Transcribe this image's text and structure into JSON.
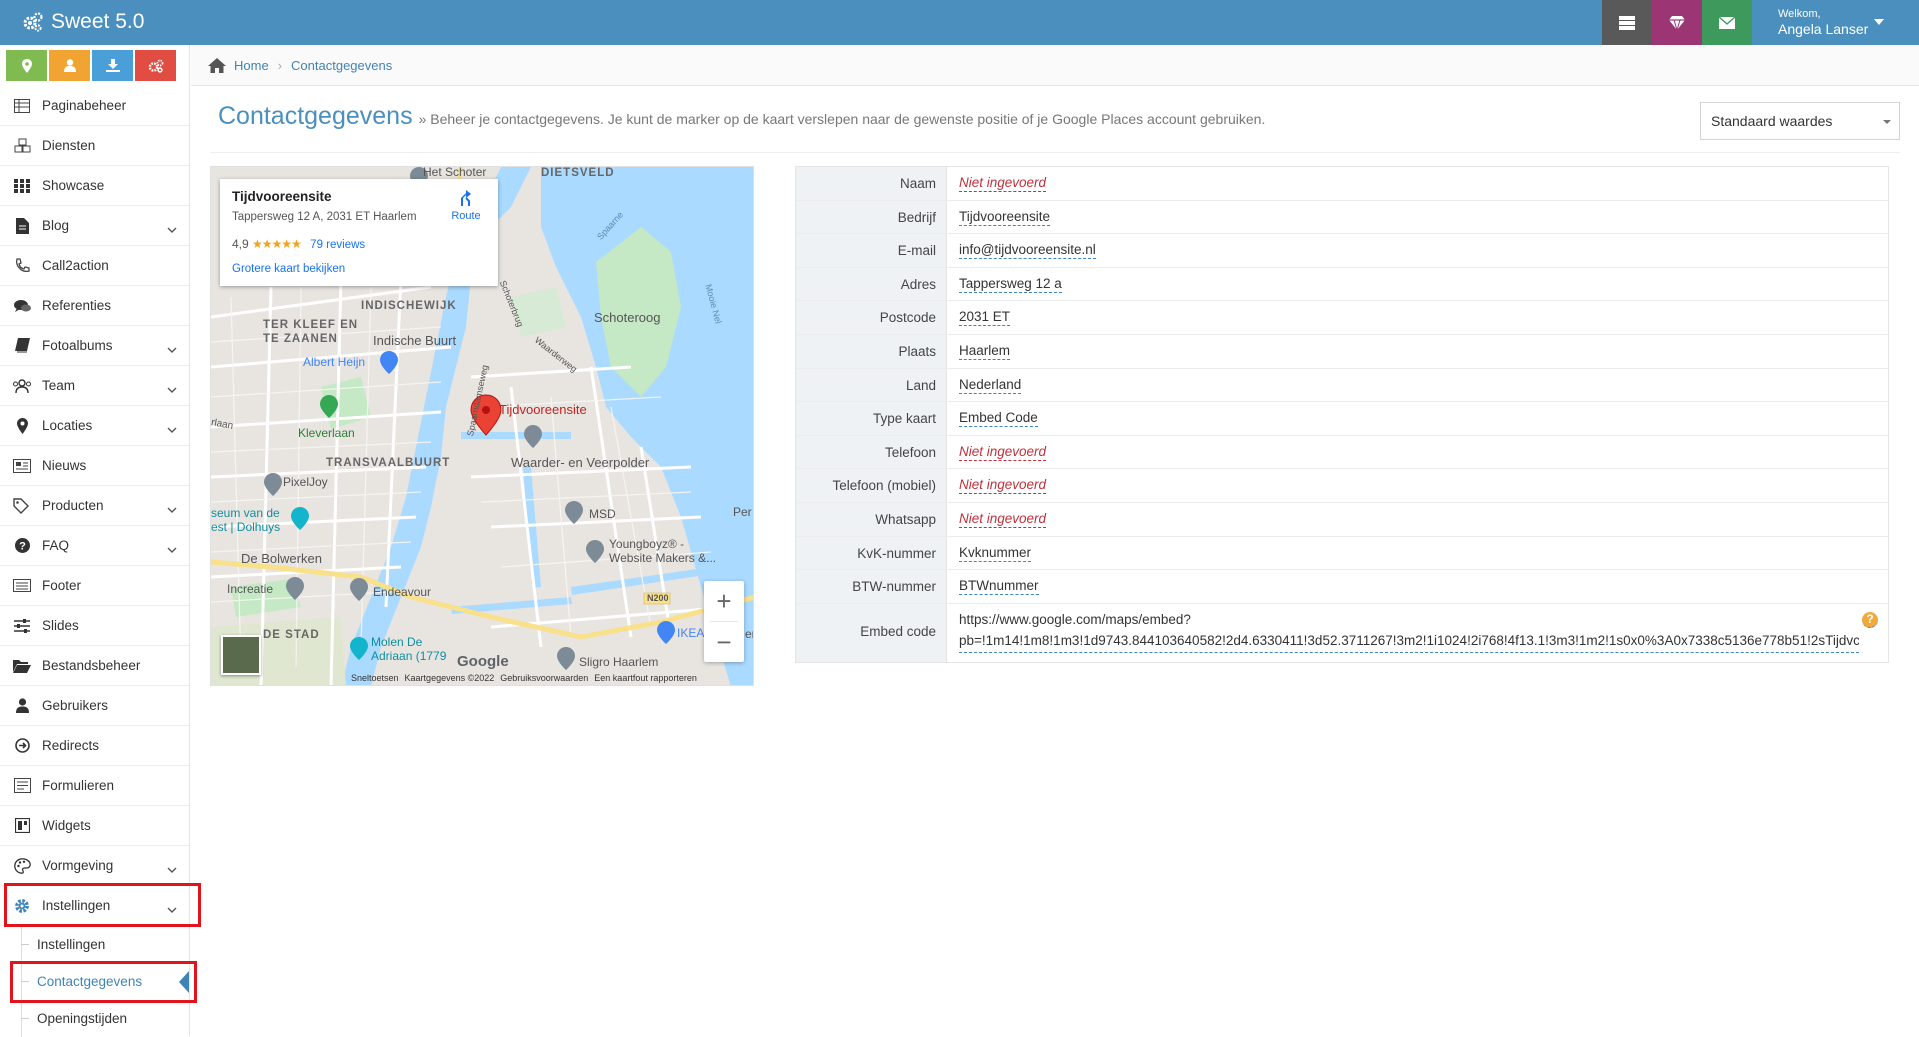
{
  "app": {
    "title": "Sweet 5.0"
  },
  "user": {
    "greeting": "Welkom,",
    "name": "Angela Lanser"
  },
  "breadcrumb": {
    "home": "Home",
    "current": "Contactgegevens"
  },
  "page": {
    "title": "Contactgegevens",
    "description": "» Beheer je contactgegevens. Je kunt de marker op de kaart verslepen naar de gewenste positie of je Google Places account gebruiken."
  },
  "preset_select": {
    "value": "Standaard waardes"
  },
  "sidebar": {
    "items": [
      {
        "label": "Paginabeheer",
        "icon": "table-icon",
        "chevron": false
      },
      {
        "label": "Diensten",
        "icon": "cubes-icon",
        "chevron": false
      },
      {
        "label": "Showcase",
        "icon": "grid-icon",
        "chevron": false
      },
      {
        "label": "Blog",
        "icon": "file-icon",
        "chevron": true
      },
      {
        "label": "Call2action",
        "icon": "phone-volume-icon",
        "chevron": false
      },
      {
        "label": "Referenties",
        "icon": "comments-icon",
        "chevron": false
      },
      {
        "label": "Fotoalbums",
        "icon": "book-icon",
        "chevron": true
      },
      {
        "label": "Team",
        "icon": "users-icon",
        "chevron": true
      },
      {
        "label": "Locaties",
        "icon": "map-marker-icon",
        "chevron": true
      },
      {
        "label": "Nieuws",
        "icon": "newspaper-icon",
        "chevron": false
      },
      {
        "label": "Producten",
        "icon": "tags-icon",
        "chevron": true
      },
      {
        "label": "FAQ",
        "icon": "question-circle-icon",
        "chevron": true
      },
      {
        "label": "Footer",
        "icon": "list-alt-icon",
        "chevron": false
      },
      {
        "label": "Slides",
        "icon": "sliders-icon",
        "chevron": false
      },
      {
        "label": "Bestandsbeheer",
        "icon": "folder-open-icon",
        "chevron": false
      },
      {
        "label": "Gebruikers",
        "icon": "user-icon",
        "chevron": false
      },
      {
        "label": "Redirects",
        "icon": "arrow-circle-icon",
        "chevron": false
      },
      {
        "label": "Formulieren",
        "icon": "form-icon",
        "chevron": false
      },
      {
        "label": "Widgets",
        "icon": "widget-icon",
        "chevron": false
      },
      {
        "label": "Vormgeving",
        "icon": "palette-icon",
        "chevron": true
      },
      {
        "label": "Instellingen",
        "icon": "gear-icon",
        "chevron": true
      }
    ],
    "sub_items": [
      {
        "label": "Instellingen"
      },
      {
        "label": "Contactgegevens"
      },
      {
        "label": "Openingstijden"
      }
    ]
  },
  "map": {
    "place_name": "Tijdvooreensite",
    "address": "Tappersweg 12 A, 2031 ET Haarlem",
    "rating": "4,9",
    "stars": "★★★★★",
    "reviews": "79 reviews",
    "bigger_map_link": "Grotere kaart bekijken",
    "route_label": "Route",
    "marker_label": "Tijdvooreensite",
    "labels": {
      "het_schoter": "Het Schoter",
      "dietsveld": "DIETSVELD",
      "indischewijk": "INDISCHEWIJK",
      "ter_kleef": "TER KLEEF EN",
      "te_zaanen": "TE ZAANEN",
      "indische_buurt": "Indische Buurt",
      "albert_heijn": "Albert Heijn",
      "schoteroog": "Schoteroog",
      "kleverlaan": "Kleverlaan",
      "transvaalbuurt": "TRANSVAALBUURT",
      "waarder": "Waarder- en Veerpolder",
      "pixeljoy": "PixelJoy",
      "museum1": "seum van de",
      "museum2": "est | Dolhuys",
      "msd": "MSD",
      "youngboyz1": "Youngboyz® -",
      "youngboyz2": "Website Makers &...",
      "bolwerken": "De Bolwerken",
      "increatie": "Increatie",
      "endeavour": "Endeavour",
      "n200": "N200",
      "de_stad": "DE STAD",
      "molen1": "Molen De",
      "molen2": "Adriaan (1779",
      "ikea": "IKEA",
      "sligro": "Sligro Haarlem",
      "per": "Per",
      "er": "er",
      "rlaan": "rlaan",
      "schoterbrug": "Schoterbrug",
      "waarderweg": "Waarderweg",
      "spaarndamseweg": "Spaarndamseweg",
      "spaarne": "Spaarne",
      "mooie_nel": "Mooie Nel"
    },
    "google_logo": "Google",
    "footer": [
      "Sneltoetsen",
      "Kaartgegevens ©2022",
      "Gebruiksvoorwaarden",
      "Een kaartfout rapporteren"
    ],
    "zoom_in": "+",
    "zoom_out": "−"
  },
  "contact": {
    "placeholder_empty": "Niet ingevoerd",
    "rows": [
      {
        "label": "Naam",
        "value": "Niet ingevoerd",
        "empty": true
      },
      {
        "label": "Bedrijf",
        "value": "Tijdvooreensite",
        "empty": false
      },
      {
        "label": "E-mail",
        "value": "info@tijdvooreensite.nl",
        "empty": false
      },
      {
        "label": "Adres",
        "value": "Tappersweg 12 a",
        "empty": false
      },
      {
        "label": "Postcode",
        "value": "2031 ET",
        "empty": false
      },
      {
        "label": "Plaats",
        "value": "Haarlem",
        "empty": false
      },
      {
        "label": "Land",
        "value": "Nederland",
        "empty": false
      },
      {
        "label": "Type kaart",
        "value": "Embed Code",
        "empty": false
      },
      {
        "label": "Telefoon",
        "value": "Niet ingevoerd",
        "empty": true
      },
      {
        "label": "Telefoon (mobiel)",
        "value": "Niet ingevoerd",
        "empty": true
      },
      {
        "label": "Whatsapp",
        "value": "Niet ingevoerd",
        "empty": true
      },
      {
        "label": "KvK-nummer",
        "value": "Kvknummer",
        "empty": false
      },
      {
        "label": "BTW-nummer",
        "value": "BTWnummer",
        "empty": false
      }
    ],
    "embed": {
      "label": "Embed code",
      "line1": "https://www.google.com/maps/embed?",
      "line2": "pb=!1m14!1m8!1m3!1d9743.844103640582!2d4.6330411!3d52.3711267!3m2!1i1024!2i768!4f13.1!3m3!1m2!1s0x0%3A0x7338c5136e778b51!2sTijdvc"
    }
  },
  "colors": {
    "topbar": "#4a8fbe",
    "accent": "#3f84b8",
    "highlight": "#e3131b",
    "empty_value": "#c0323c"
  }
}
